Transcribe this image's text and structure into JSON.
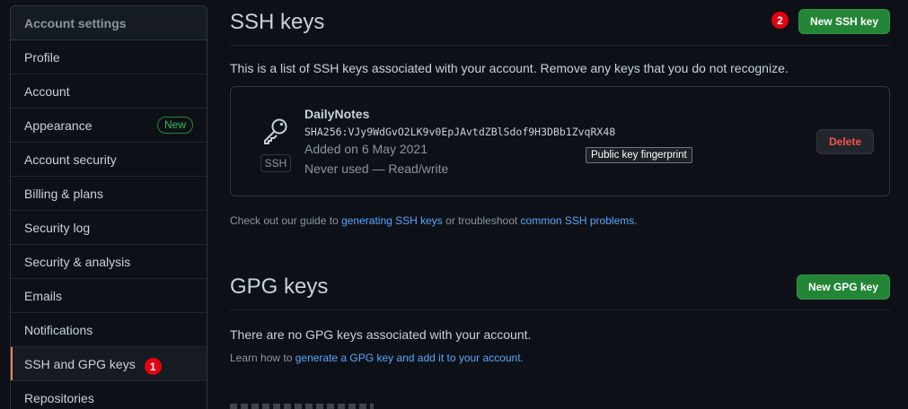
{
  "sidebar": {
    "header": "Account settings",
    "items": [
      {
        "label": "Profile"
      },
      {
        "label": "Account"
      },
      {
        "label": "Appearance",
        "badge": "New"
      },
      {
        "label": "Account security"
      },
      {
        "label": "Billing & plans"
      },
      {
        "label": "Security log"
      },
      {
        "label": "Security & analysis"
      },
      {
        "label": "Emails"
      },
      {
        "label": "Notifications"
      },
      {
        "label": "SSH and GPG keys",
        "selected": true,
        "marker": "1"
      },
      {
        "label": "Repositories"
      }
    ]
  },
  "ssh": {
    "title": "SSH keys",
    "new_button": "New SSH key",
    "marker": "2",
    "description": "This is a list of SSH keys associated with your account. Remove any keys that you do not recognize.",
    "key": {
      "name": "DailyNotes",
      "fingerprint": "SHA256:VJy9WdGvO2LK9v0EpJAvtdZBlSdof9H3DBb1ZvqRX48",
      "added": "Added on 6 May 2021",
      "usage": "Never used — Read/write",
      "type_label": "SSH",
      "tooltip": "Public key fingerprint",
      "delete_button": "Delete"
    },
    "guide": {
      "prefix": "Check out our guide to ",
      "link1": "generating SSH keys",
      "middle": " or troubleshoot ",
      "link2": "common SSH problems",
      "suffix": "."
    }
  },
  "gpg": {
    "title": "GPG keys",
    "new_button": "New GPG key",
    "empty": "There are no GPG keys associated with your account.",
    "learn": {
      "prefix": "Learn how to ",
      "link": "generate a GPG key and add it to your account",
      "suffix": "."
    }
  },
  "colors": {
    "background": "#0d1117",
    "accent_green": "#238636",
    "link": "#58a6ff",
    "danger": "#f85149",
    "selected_indicator": "#f78166",
    "marker": "#e5000f"
  }
}
